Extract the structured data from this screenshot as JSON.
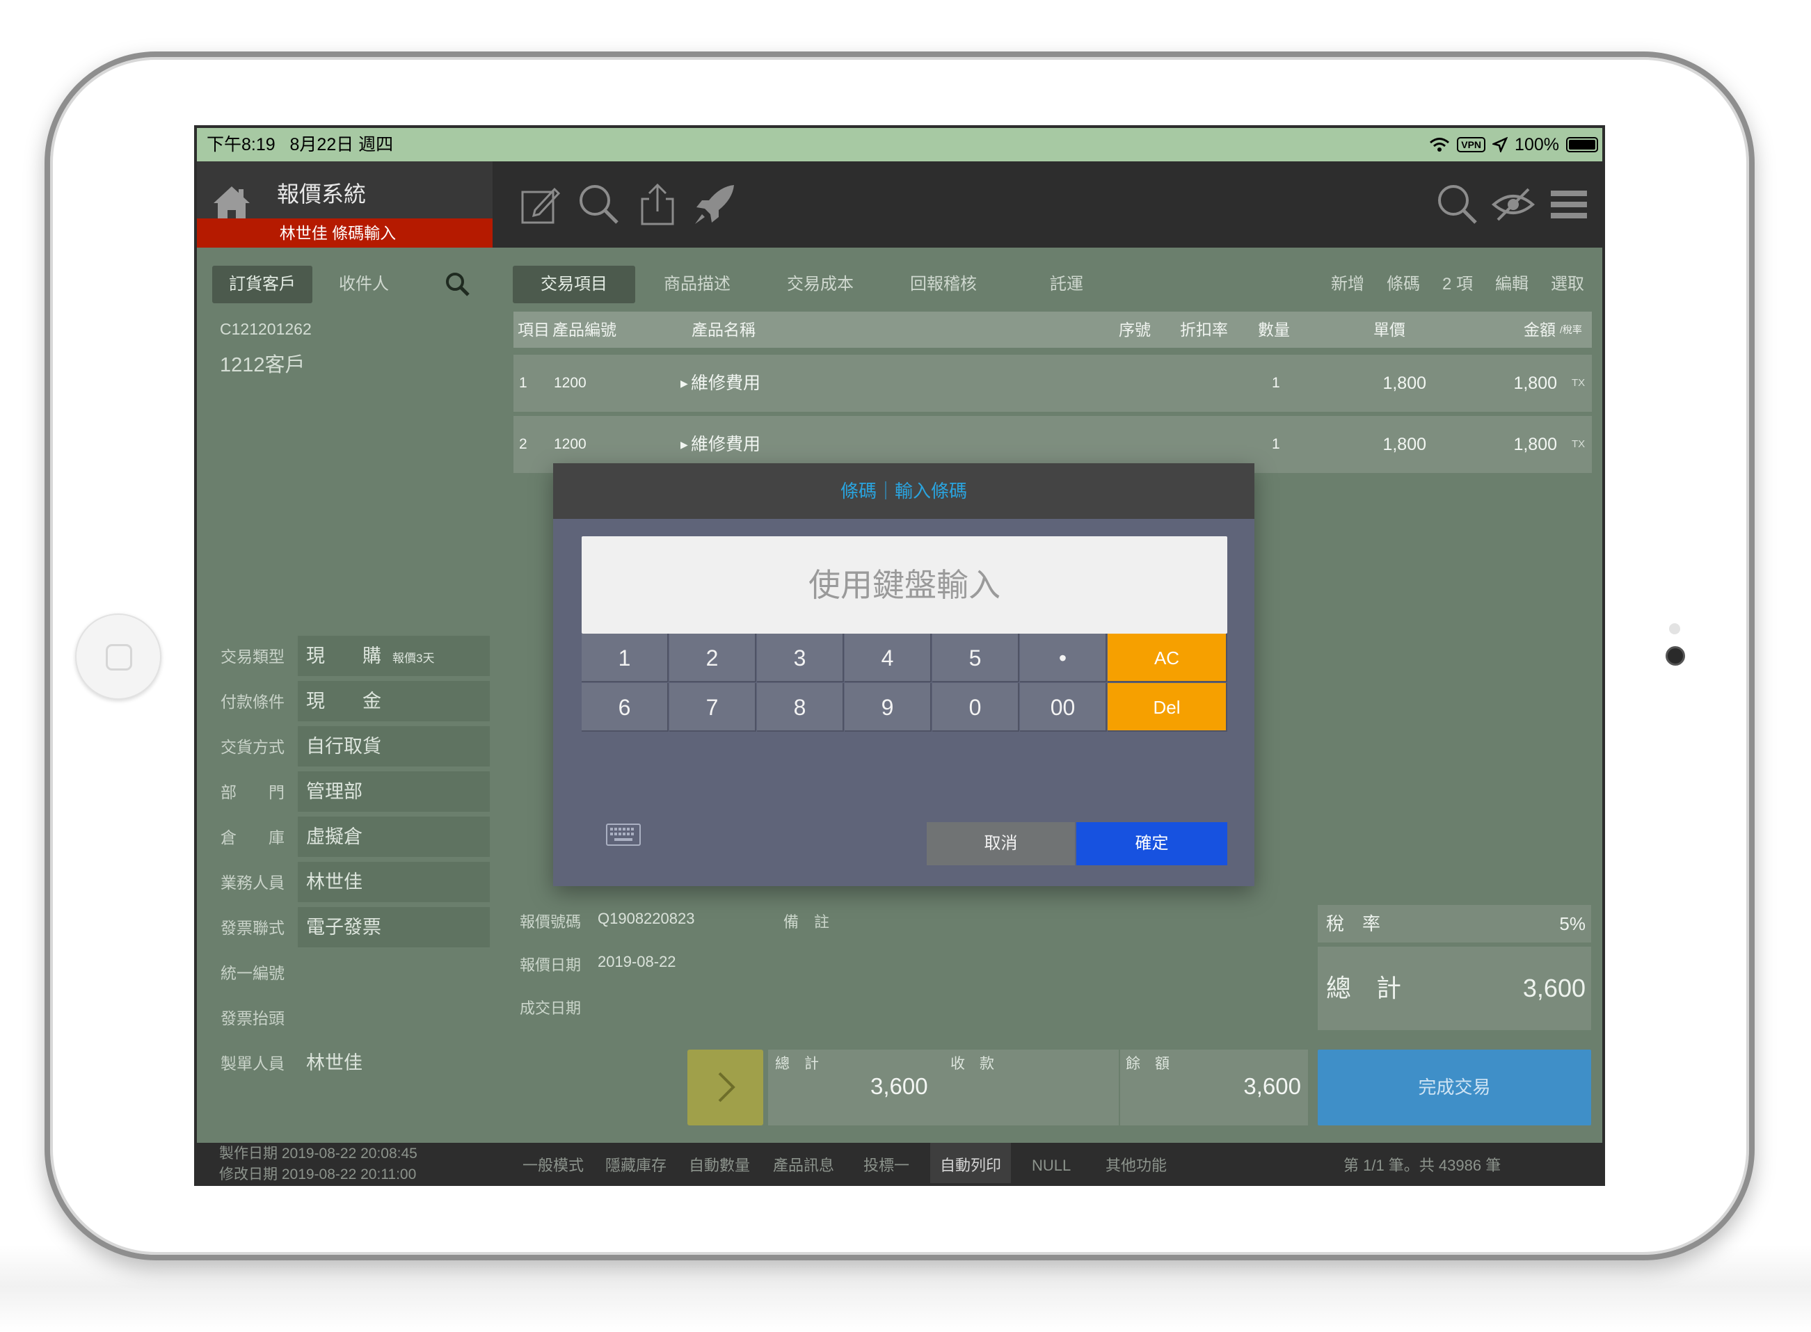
{
  "status": {
    "time": "下午8:19",
    "date": "8月22日 週四",
    "vpn": "VPN",
    "battery": "100%"
  },
  "brand": {
    "title": "報價系統",
    "subtitle": "林世佳  條碼輸入"
  },
  "toolbar_icons": [
    "edit-icon",
    "search-icon",
    "share-icon",
    "rocket-icon",
    "search-icon",
    "eye-off-icon",
    "menu-icon"
  ],
  "left_tabs": [
    "訂貨客戶",
    "收件人"
  ],
  "customer": {
    "id": "C121201262",
    "name": "1212客戶"
  },
  "fields": [
    {
      "label": "交易類型",
      "value": "現　　購",
      "note": "報價3天"
    },
    {
      "label": "付款條件",
      "value": "現　　金"
    },
    {
      "label": "交貨方式",
      "value": "自行取貨"
    },
    {
      "label": "部　　門",
      "value": "管理部"
    },
    {
      "label": "倉　　庫",
      "value": "虛擬倉"
    },
    {
      "label": "業務人員",
      "value": "林世佳"
    },
    {
      "label": "發票聯式",
      "value": "電子發票"
    },
    {
      "label": "統一編號",
      "value": ""
    },
    {
      "label": "發票抬頭",
      "value": ""
    },
    {
      "label": "製單人員",
      "value": "林世佳"
    }
  ],
  "right_tabs": [
    "交易項目",
    "商品描述",
    "交易成本",
    "回報稽核",
    "託運"
  ],
  "right_actions": [
    "新增",
    "條碼",
    "2 項",
    "編輯",
    "選取"
  ],
  "grid": {
    "headers": {
      "item": "項目",
      "code": "產品編號",
      "name": "產品名稱",
      "serial": "序號",
      "discount": "折扣率",
      "qty": "數量",
      "price": "單價",
      "amount": "金額",
      "tax": "/稅率"
    },
    "rows": [
      {
        "item": "1",
        "code": "1200",
        "name": "維修費用",
        "qty": "1",
        "price": "1,800",
        "amount": "1,800",
        "tax": "TX"
      },
      {
        "item": "2",
        "code": "1200",
        "name": "維修費用",
        "qty": "1",
        "price": "1,800",
        "amount": "1,800",
        "tax": "TX"
      }
    ]
  },
  "quote": {
    "no_label": "報價號碼",
    "no": "Q1908220823",
    "note_label": "備　註",
    "date_label": "報價日期",
    "date": "2019-08-22",
    "deal_label": "成交日期",
    "deal": ""
  },
  "summary": {
    "tax_label": "稅　率",
    "tax": "5%",
    "total_label": "總　計",
    "total": "3,600"
  },
  "payment": {
    "total_label": "總　計",
    "total": "3,600",
    "received_label": "收　款",
    "balance_label": "餘　額",
    "balance": "3,600"
  },
  "finish_label": "完成交易",
  "footer": {
    "created": "製作日期  2019-08-22  20:08:45",
    "modified": "修改日期  2019-08-22  20:11:00",
    "modes": [
      "一般模式",
      "隱藏庫存",
      "自動數量",
      "產品訊息",
      "投標一",
      "自動列印",
      "NULL",
      "其他功能"
    ],
    "active_mode": "自動列印",
    "record": "第 1/1 筆。共 43986 筆"
  },
  "dialog": {
    "title": "條碼｜輸入條碼",
    "placeholder": "使用鍵盤輸入",
    "keys_row1": [
      "1",
      "2",
      "3",
      "4",
      "5",
      "•",
      "AC"
    ],
    "keys_row2": [
      "6",
      "7",
      "8",
      "9",
      "0",
      "00",
      "Del"
    ],
    "cancel": "取消",
    "ok": "確定"
  },
  "colors": {
    "accent_red": "#b51a00",
    "dialog_blue": "#1752e0",
    "key_orange": "#f6a000",
    "finish_blue": "#3f8fc8"
  }
}
